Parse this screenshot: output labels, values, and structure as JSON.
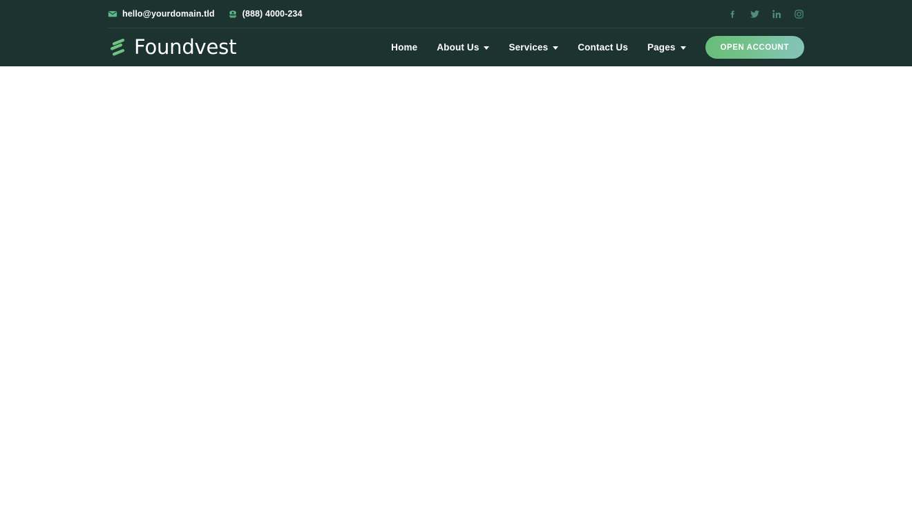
{
  "site": {
    "brand_name": "Foundvest",
    "logo_icon": "foundvest-bars-logo",
    "header_bg": "#1d3330",
    "accent_green": "#5bb98a",
    "social_icon_color": "#4e8f80",
    "cta_gradient_from": "#68bd79",
    "cta_gradient_to": "#84c3bc"
  },
  "topbar": {
    "email_icon": "envelope-icon",
    "email": "hello@yourdomain.tld",
    "phone_icon": "telephone-icon",
    "phone": "(888) 4000-234",
    "social": [
      {
        "name": "facebook-icon",
        "label": "f"
      },
      {
        "name": "twitter-icon",
        "label": "t"
      },
      {
        "name": "linkedin-icon",
        "label": "in"
      },
      {
        "name": "instagram-icon",
        "label": "ig"
      }
    ]
  },
  "nav": {
    "items": [
      {
        "label": "Home",
        "has_dropdown": false
      },
      {
        "label": "About Us",
        "has_dropdown": true
      },
      {
        "label": "Services",
        "has_dropdown": true
      },
      {
        "label": "Contact Us",
        "has_dropdown": false
      },
      {
        "label": "Pages",
        "has_dropdown": true
      }
    ],
    "cta_label": "OPEN ACCOUNT"
  }
}
